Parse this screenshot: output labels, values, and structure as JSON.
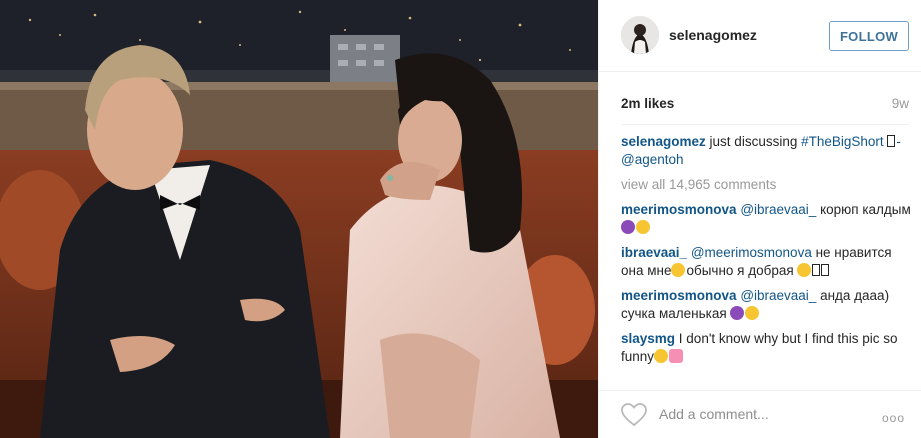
{
  "post": {
    "photo_alt": ""
  },
  "header": {
    "username": "selenagomez",
    "follow_label": "FOLLOW"
  },
  "stats": {
    "likes": "2m likes",
    "age": "9w"
  },
  "caption": {
    "user": "selenagomez",
    "text": " just discussing ",
    "hashtag": "#TheBigShort",
    "mention": "-@agentoh"
  },
  "view_all": "view all 14,965 comments",
  "comments": [
    {
      "user": "meerimosmonova",
      "mention": "@ibraevaai_",
      "text": " корюп калдым "
    },
    {
      "user": "ibraevaai_",
      "mention": "@meerimosmonova",
      "text": " не нравится она мне",
      "text2": "обычно я добрая "
    },
    {
      "user": "meerimosmonova",
      "mention": "@ibraevaai_",
      "text": " анда дааа) сучка маленькая "
    },
    {
      "user": "slaysmg",
      "text": " I don't know why but I find this pic so funny"
    }
  ],
  "footer": {
    "placeholder": "Add a comment...",
    "more": "ooo"
  },
  "colors": {
    "link": "#125688",
    "follow_border": "#6e9fc9",
    "muted": "#999999"
  },
  "icons": [
    "heart-icon",
    "more-options-icon",
    "avatar-icon"
  ]
}
